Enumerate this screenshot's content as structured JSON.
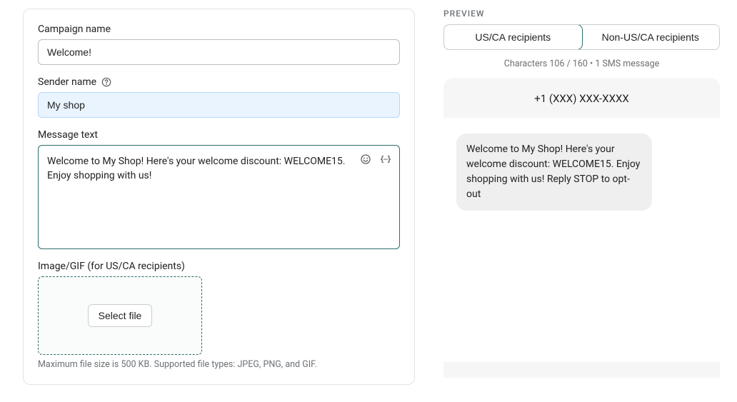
{
  "form": {
    "campaign_name_label": "Campaign name",
    "campaign_name_value": "Welcome!",
    "sender_name_label": "Sender name",
    "sender_name_value": "My shop",
    "message_text_label": "Message text",
    "message_text_value": "Welcome to My Shop! Here's your welcome discount: WELCOME15. Enjoy shopping with us!",
    "image_label": "Image/GIF (for US/CA recipients)",
    "select_file_label": "Select file",
    "file_hint": "Maximum file size is 500 KB. Supported file types: JPEG, PNG, and GIF."
  },
  "preview": {
    "title": "PREVIEW",
    "tab_active": "US/CA recipients",
    "tab_inactive": "Non-US/CA recipients",
    "stats": "Characters 106 / 160 • 1 SMS message",
    "phone_number": "+1 (XXX) XXX-XXXX",
    "bubble_text": "Welcome to My Shop! Here's your welcome discount: WELCOME15. Enjoy shopping with us! Reply STOP to opt-out"
  }
}
